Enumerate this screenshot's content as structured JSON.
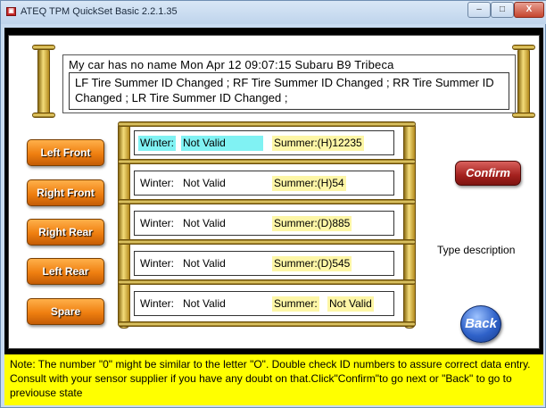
{
  "window": {
    "title": "ATEQ TPM QuickSet Basic  2.2.1.35",
    "minimize": "–",
    "maximize": "□",
    "close": "X"
  },
  "header": {
    "line1": "My car has no name  Mon Apr  12 09:07:15   Subaru   B9 Tribeca",
    "message": "LF Tire Summer ID Changed ; RF Tire Summer ID Changed ; RR Tire Summer ID Changed ; LR Tire Summer ID Changed ;"
  },
  "tires": [
    {
      "label": "Left  Front",
      "winter_label": "Winter:",
      "winter_value": "Not Valid",
      "summer_label": "Summer:(H)12235",
      "summer_value": ""
    },
    {
      "label": "Right Front",
      "winter_label": "Winter:",
      "winter_value": "Not Valid",
      "summer_label": "Summer:(H)54",
      "summer_value": ""
    },
    {
      "label": "Right Rear",
      "winter_label": "Winter:",
      "winter_value": "Not Valid",
      "summer_label": "Summer:(D)885",
      "summer_value": ""
    },
    {
      "label": "Left  Rear",
      "winter_label": "Winter:",
      "winter_value": "Not Valid",
      "summer_label": "Summer:(D)545",
      "summer_value": ""
    },
    {
      "label": "Spare",
      "winter_label": "Winter:",
      "winter_value": "Not Valid",
      "summer_label": "Summer:",
      "summer_value": "Not Valid"
    }
  ],
  "actions": {
    "confirm": "Confirm",
    "back": "Back",
    "type_description": "Type description"
  },
  "note": "Note: The number \"0\" might be similar to the letter \"O\". Double check ID numbers to assure correct data entry. Consult with your sensor supplier if you have any doubt on that.Click\"Confirm\"to go next or \"Back\" to go to previouse state",
  "colors": {
    "tire_button": "#ef7f10",
    "winter_highlight": "#80f2f3",
    "summer_highlight": "#fdf6a6",
    "note_background": "#ffff00",
    "confirm_button": "#a3201d",
    "back_button": "#2f62c9",
    "frame_gold": "#f3dc7a"
  }
}
